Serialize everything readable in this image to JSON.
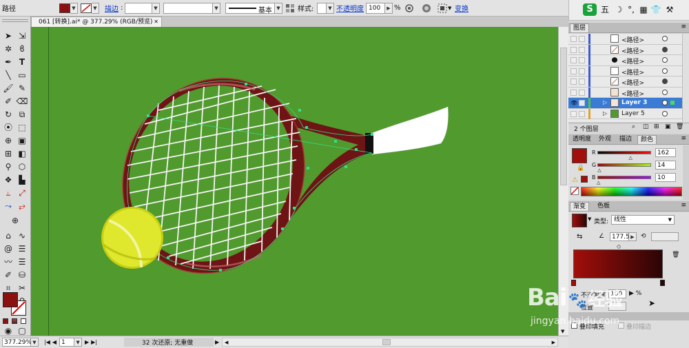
{
  "control_bar": {
    "object_type": "路径",
    "stroke_label": "描边",
    "stroke_style": "基本",
    "style_label": "样式:",
    "opacity_label": "不透明度",
    "opacity_value": "100",
    "percent": "%",
    "transform_label": "变换",
    "fill_color": "#8b1010"
  },
  "document_tab": {
    "title": "061 [转换].ai* @ 377.29% (RGB/预览)",
    "close": "✕"
  },
  "tray": {
    "ime": "五",
    "icons": [
      "moon-icon",
      "punct-icon",
      "keyboard-icon",
      "shirt-icon",
      "wrench-icon"
    ]
  },
  "layers": {
    "title": "图层",
    "rows": [
      {
        "name": "<路径>",
        "thumb": "rect-outline"
      },
      {
        "name": "<路径>",
        "thumb": "diagonal"
      },
      {
        "name": "<路径>",
        "thumb": "blob"
      },
      {
        "name": "<路径>",
        "thumb": "rect-outline"
      },
      {
        "name": "<路径>",
        "thumb": "diagonal"
      },
      {
        "name": "<路径>",
        "thumb": "tan-rect"
      }
    ],
    "layer3": "Layer 3",
    "layer5": "Layer 5",
    "count": "2 个图层"
  },
  "color_panel": {
    "tabs": [
      "透明度",
      "外观",
      "描边",
      "颜色"
    ],
    "r_label": "R",
    "g_label": "G",
    "b_label": "B",
    "r": "162",
    "g": "14",
    "b": "10",
    "r_fraction": 0.635,
    "g_fraction": 0.055,
    "b_fraction": 0.039
  },
  "gradient_panel": {
    "tabs": [
      "渐变",
      "色板"
    ],
    "type_label": "类型:",
    "type_value": "线性",
    "angle": "177.5",
    "opacity_label": "不透明度",
    "opacity_value": "100",
    "position_label": "位置",
    "overprint_fill": "叠印填充",
    "overprint_stroke": "叠印描边"
  },
  "status_bar": {
    "zoom": "377.29%",
    "artboard": "1",
    "history": "32 次还原; 无重做"
  },
  "watermark": {
    "brand": "Bai",
    "brand_cn": "经验",
    "url": "jingyan.baidu.com"
  },
  "colors": {
    "canvas": "#519a2e",
    "racket": "#6e1414",
    "ball": "#d8e21c",
    "selection": "#3a7bd5"
  }
}
